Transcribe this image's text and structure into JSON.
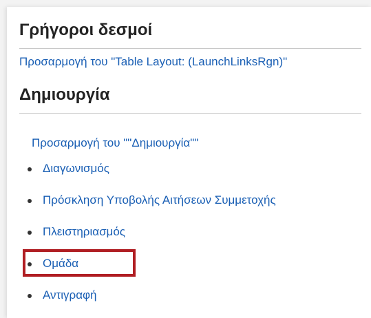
{
  "quick_links": {
    "title": "Γρήγοροι δεσμοί",
    "customize_link": "Προσαρμογή του \"Table Layout: (LaunchLinksRgn)\""
  },
  "create": {
    "title": "Δημιουργία",
    "customize_link": "Προσαρμογή του \"\"Δημιουργία\"\"",
    "items": [
      {
        "label": "Διαγωνισμός"
      },
      {
        "label": "Πρόσκληση Υποβολής Αιτήσεων Συμμετοχής"
      },
      {
        "label": "Πλειστηριασμός"
      },
      {
        "label": "Ομάδα"
      },
      {
        "label": "Αντιγραφή"
      }
    ]
  },
  "colors": {
    "link": "#1a5fb4",
    "heading": "#222222",
    "highlight": "#b01e23"
  }
}
